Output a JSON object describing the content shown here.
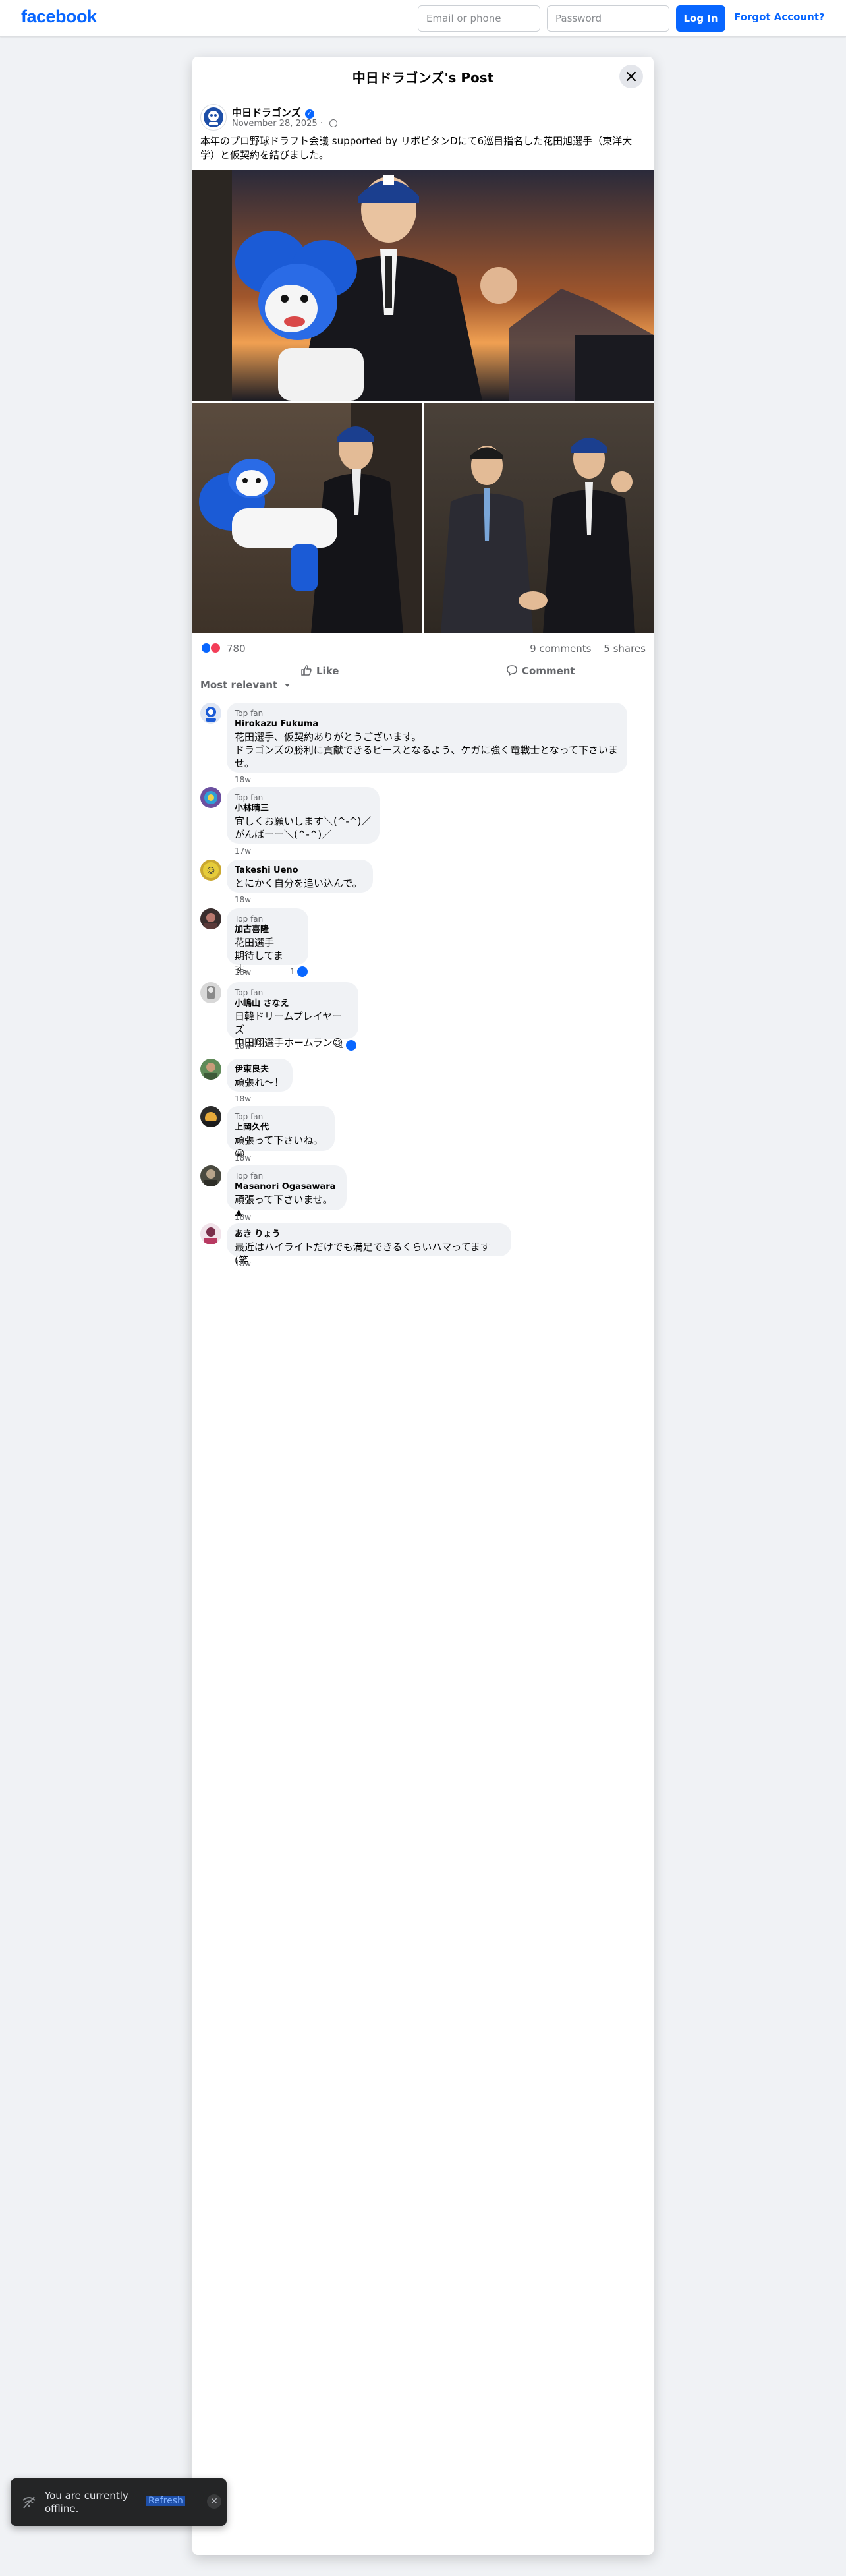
{
  "topbar": {
    "logo": "facebook",
    "email_placeholder": "Email or phone",
    "password_placeholder": "Password",
    "login_label": "Log In",
    "forgot_label": "Forgot Account?"
  },
  "modal": {
    "title": "中日ドラゴンズ's Post",
    "close_icon": "close-icon"
  },
  "post": {
    "page_name": "中日ドラゴンズ",
    "date": "November 28, 2025",
    "text": "本年のプロ野球ドラフト会議 supported by リポビタンDにて6巡目指名した花田旭選手（東洋大学）と仮契約を結びました。",
    "reaction_count": "780",
    "comments_count": "9 comments",
    "shares_count": "5 shares",
    "like_label": "Like",
    "comment_label": "Comment",
    "sort_label": "Most relevant"
  },
  "comments": [
    {
      "badge": "Top fan",
      "name": "Hirokazu Fukuma",
      "text": "花田選手、仮契約ありがとうございます。\nドラゴンズの勝利に貢献できるピースとなるよう、ケガに強く竜戦士となって下さいませ。",
      "time": "18w",
      "likes": ""
    },
    {
      "badge": "Top fan",
      "name": "小林晴三",
      "text": "宜しくお願いします＼(^-^)／\nがんばーー＼(^-^)／",
      "time": "17w",
      "likes": ""
    },
    {
      "badge": "",
      "name": "Takeshi Ueno",
      "text": "とにかく自分を追い込んで。",
      "time": "18w",
      "likes": ""
    },
    {
      "badge": "Top fan",
      "name": "加古喜隆",
      "text": "花田選手\n期待してます。",
      "time": "18w",
      "likes": "1"
    },
    {
      "badge": "Top fan",
      "name": "小嶋山 さなえ",
      "text": "日韓ドリームプレイヤーズ\n中田翔選手ホームラン😊",
      "time": "18w",
      "likes": "1"
    },
    {
      "badge": "",
      "name": "伊東良夫",
      "text": "頑張れ〜！",
      "time": "18w",
      "likes": ""
    },
    {
      "badge": "Top fan",
      "name": "上岡久代",
      "text": "頑張って下さいね。😀",
      "time": "18w",
      "likes": ""
    },
    {
      "badge": "Top fan",
      "name": "Masanori Ogasawara",
      "text": "頑張って下さいませ。⛰",
      "time": "18w",
      "likes": ""
    },
    {
      "badge": "",
      "name": "あき りょう",
      "text": "最近はハイライトだけでも満足できるくらいハマってます(笑",
      "time": "18w",
      "likes": ""
    }
  ],
  "toast": {
    "text": "You are currently offline.",
    "refresh_label": "Refresh"
  },
  "colors": {
    "brand": "#0866ff",
    "toast_bg": "#242526"
  }
}
